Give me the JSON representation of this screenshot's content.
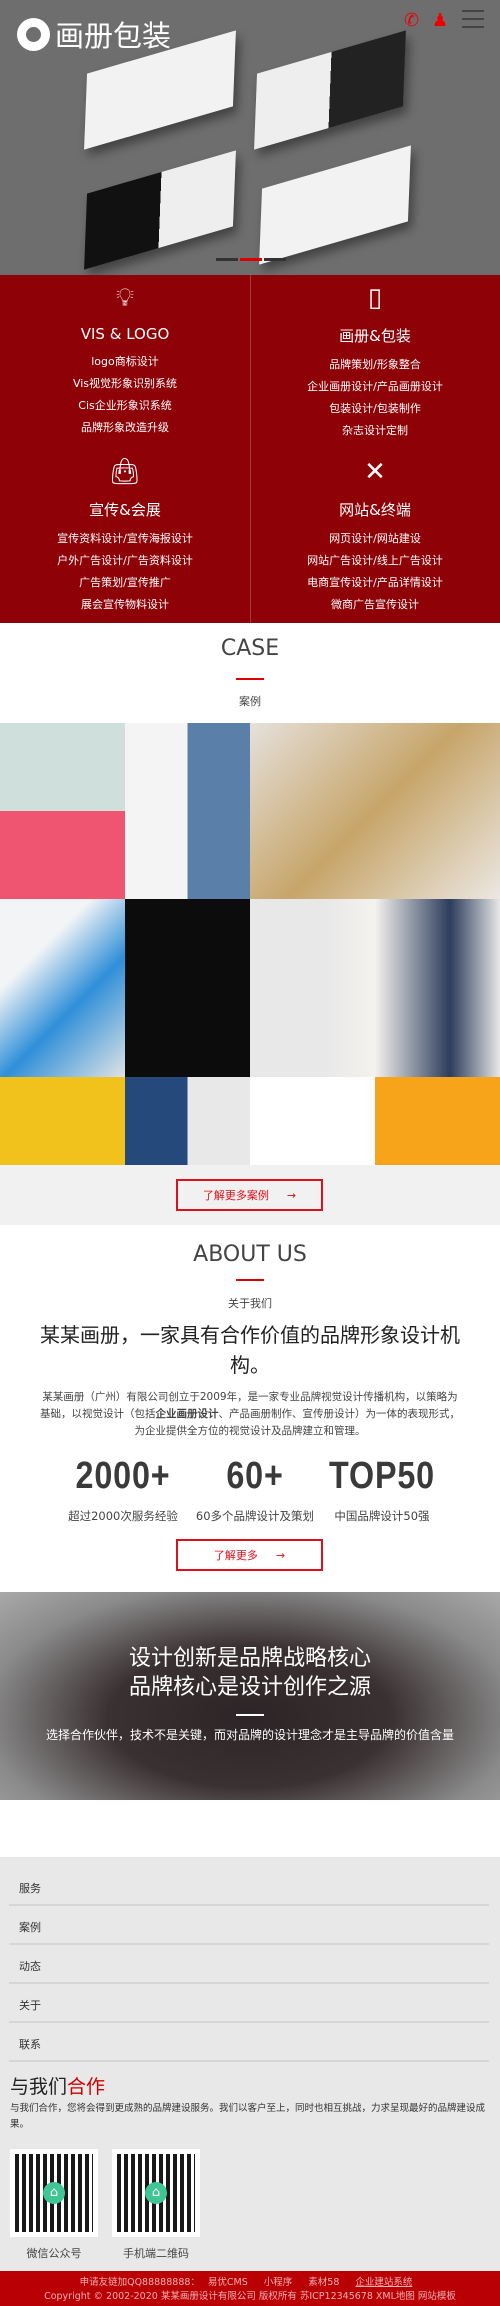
{
  "header": {
    "logo_text": "画册包装",
    "icons": [
      "phone-icon",
      "qq-icon",
      "menu-icon"
    ]
  },
  "hero": {
    "slides": 3,
    "active_slide": 2
  },
  "services": [
    {
      "icon": "lightbulb-icon",
      "title": "VIS & LOGO",
      "items": [
        "logo商标设计",
        "Vis视觉形象识别系统",
        "Cis企业形象识系统",
        "品牌形象改造升级"
      ]
    },
    {
      "icon": "book-icon",
      "title": "画册&包装",
      "items": [
        "品牌策划/形象整合",
        "企业画册设计/产品画册设计",
        "包装设计/包装制作",
        "杂志设计定制"
      ]
    },
    {
      "icon": "shopping-bag-icon",
      "title": "宣传&会展",
      "items": [
        "宣传资料设计/宣传海报设计",
        "户外广告设计/广告资料设计",
        "广告策划/宣传推广",
        "展会宣传物料设计"
      ]
    },
    {
      "icon": "pencil-ruler-icon",
      "title": "网站&终端",
      "items": [
        "网页设计/网站建设",
        "网站广告设计/线上广告设计",
        "电商宣传设计/产品详情设计",
        "微商广告宣传设计"
      ]
    }
  ],
  "case": {
    "title": "CASE",
    "subtitle": "案例",
    "more_label": "了解更多案例",
    "arrow": "→"
  },
  "about": {
    "title": "ABOUT US",
    "subtitle": "关于我们",
    "heading": "某某画册，一家具有合作价值的品牌形象设计机构。",
    "para_1": "某某画册（广州）有限公司创立于2009年，是一家专业品牌视觉设计传播机构，以策略为基础，以视觉设计（包括",
    "para_bold": "企业画册设计",
    "para_2": "、产品画册制作、宣传册设计）为一体的表现形式，为企业提供全方位的视觉设计及品牌建立和管理。",
    "stats": [
      {
        "value": "2000+",
        "label": "超过2000次服务经验"
      },
      {
        "value": "60+",
        "label": "60多个品牌设计及策划"
      },
      {
        "value": "TOP50",
        "label": "中国品牌设计50强"
      }
    ],
    "more_label": "了解更多",
    "arrow": "→"
  },
  "banner": {
    "line1": "设计创新是品牌战略核心",
    "line2": "品牌核心是设计创作之源",
    "text": "选择合作伙伴，技术不是关键，而对品牌的设计理念才是主导品牌的价值含量"
  },
  "nav": [
    "服务",
    "案例",
    "动态",
    "关于",
    "联系"
  ],
  "cooperate": {
    "title_a": "与我们",
    "title_b": "合作",
    "text": "与我们合作，您将会得到更成熟的品牌建设服务。我们以客户至上，同时也相互挑战，力求呈现最好的品牌建设成果。",
    "qr": [
      {
        "label": "微信公众号"
      },
      {
        "label": "手机端二维码"
      }
    ]
  },
  "footer": {
    "links_prefix": "申请友链加QQ88888888：",
    "links": [
      "易优CMS",
      "小程序",
      "素材58",
      "企业建站系统"
    ],
    "copyright": "Copyright © 2002-2020 某某画册设计有限公司 版权所有 苏ICP12345678 XML地图 网站模板"
  },
  "colors": {
    "brand_red": "#8e0106",
    "accent_red": "#e0101a",
    "footer_red": "#b90005"
  }
}
